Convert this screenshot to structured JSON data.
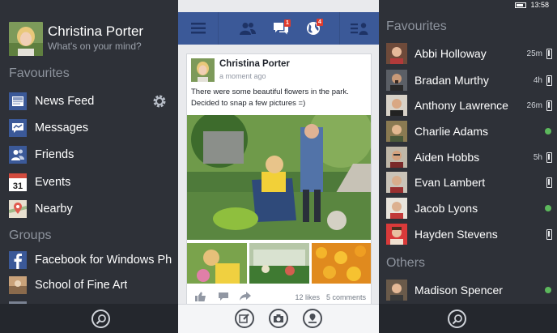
{
  "left_panel": {
    "profile": {
      "name": "Christina Porter",
      "status": "What's on your mind?"
    },
    "favourites_heading": "Favourites",
    "favourites": [
      {
        "label": "News Feed",
        "icon": "news-feed-icon"
      },
      {
        "label": "Messages",
        "icon": "messages-icon"
      },
      {
        "label": "Friends",
        "icon": "friends-icon"
      },
      {
        "label": "Events",
        "icon": "events-icon",
        "icon_text": "31"
      },
      {
        "label": "Nearby",
        "icon": "nearby-icon"
      }
    ],
    "groups_heading": "Groups",
    "groups": [
      {
        "label": "Facebook for Windows Ph",
        "icon": "facebook-icon"
      },
      {
        "label": "School of Fine Art",
        "icon": "group-icon"
      }
    ]
  },
  "center_panel": {
    "topbar": {
      "menu_icon": "menu-icon",
      "friends_icon": "friend-requests-icon",
      "messages_badge": "1",
      "notifications_badge": "4"
    },
    "post": {
      "author": "Christina Porter",
      "time": "a moment ago",
      "text": "There were some beautiful flowers in the park. Decided to snap a few pictures =)",
      "likes": "12 likes",
      "comments": "5 comments"
    },
    "bottom_bar": [
      "status-icon",
      "camera-icon",
      "check-in-icon"
    ]
  },
  "right_panel": {
    "status_time": "13:58",
    "favourites_heading": "Favourites",
    "favourites": [
      {
        "name": "Abbi Holloway",
        "time": "25m",
        "presence": "mobile"
      },
      {
        "name": "Bradan Murthy",
        "time": "4h",
        "presence": "mobile"
      },
      {
        "name": "Anthony Lawrence",
        "time": "26m",
        "presence": "mobile"
      },
      {
        "name": "Charlie Adams",
        "time": "",
        "presence": "online"
      },
      {
        "name": "Aiden Hobbs",
        "time": "5h",
        "presence": "mobile"
      },
      {
        "name": "Evan Lambert",
        "time": "",
        "presence": "mobile"
      },
      {
        "name": "Jacob Lyons",
        "time": "",
        "presence": "online"
      },
      {
        "name": "Hayden Stevens",
        "time": "",
        "presence": "mobile"
      }
    ],
    "others_heading": "Others",
    "others": [
      {
        "name": "Madison Spencer",
        "time": "",
        "presence": "online"
      }
    ]
  },
  "colors": {
    "facebook_blue": "#3b5998",
    "panel_dark": "#2e3138",
    "online_green": "#5cb85c",
    "badge_red": "#e03b2c"
  }
}
